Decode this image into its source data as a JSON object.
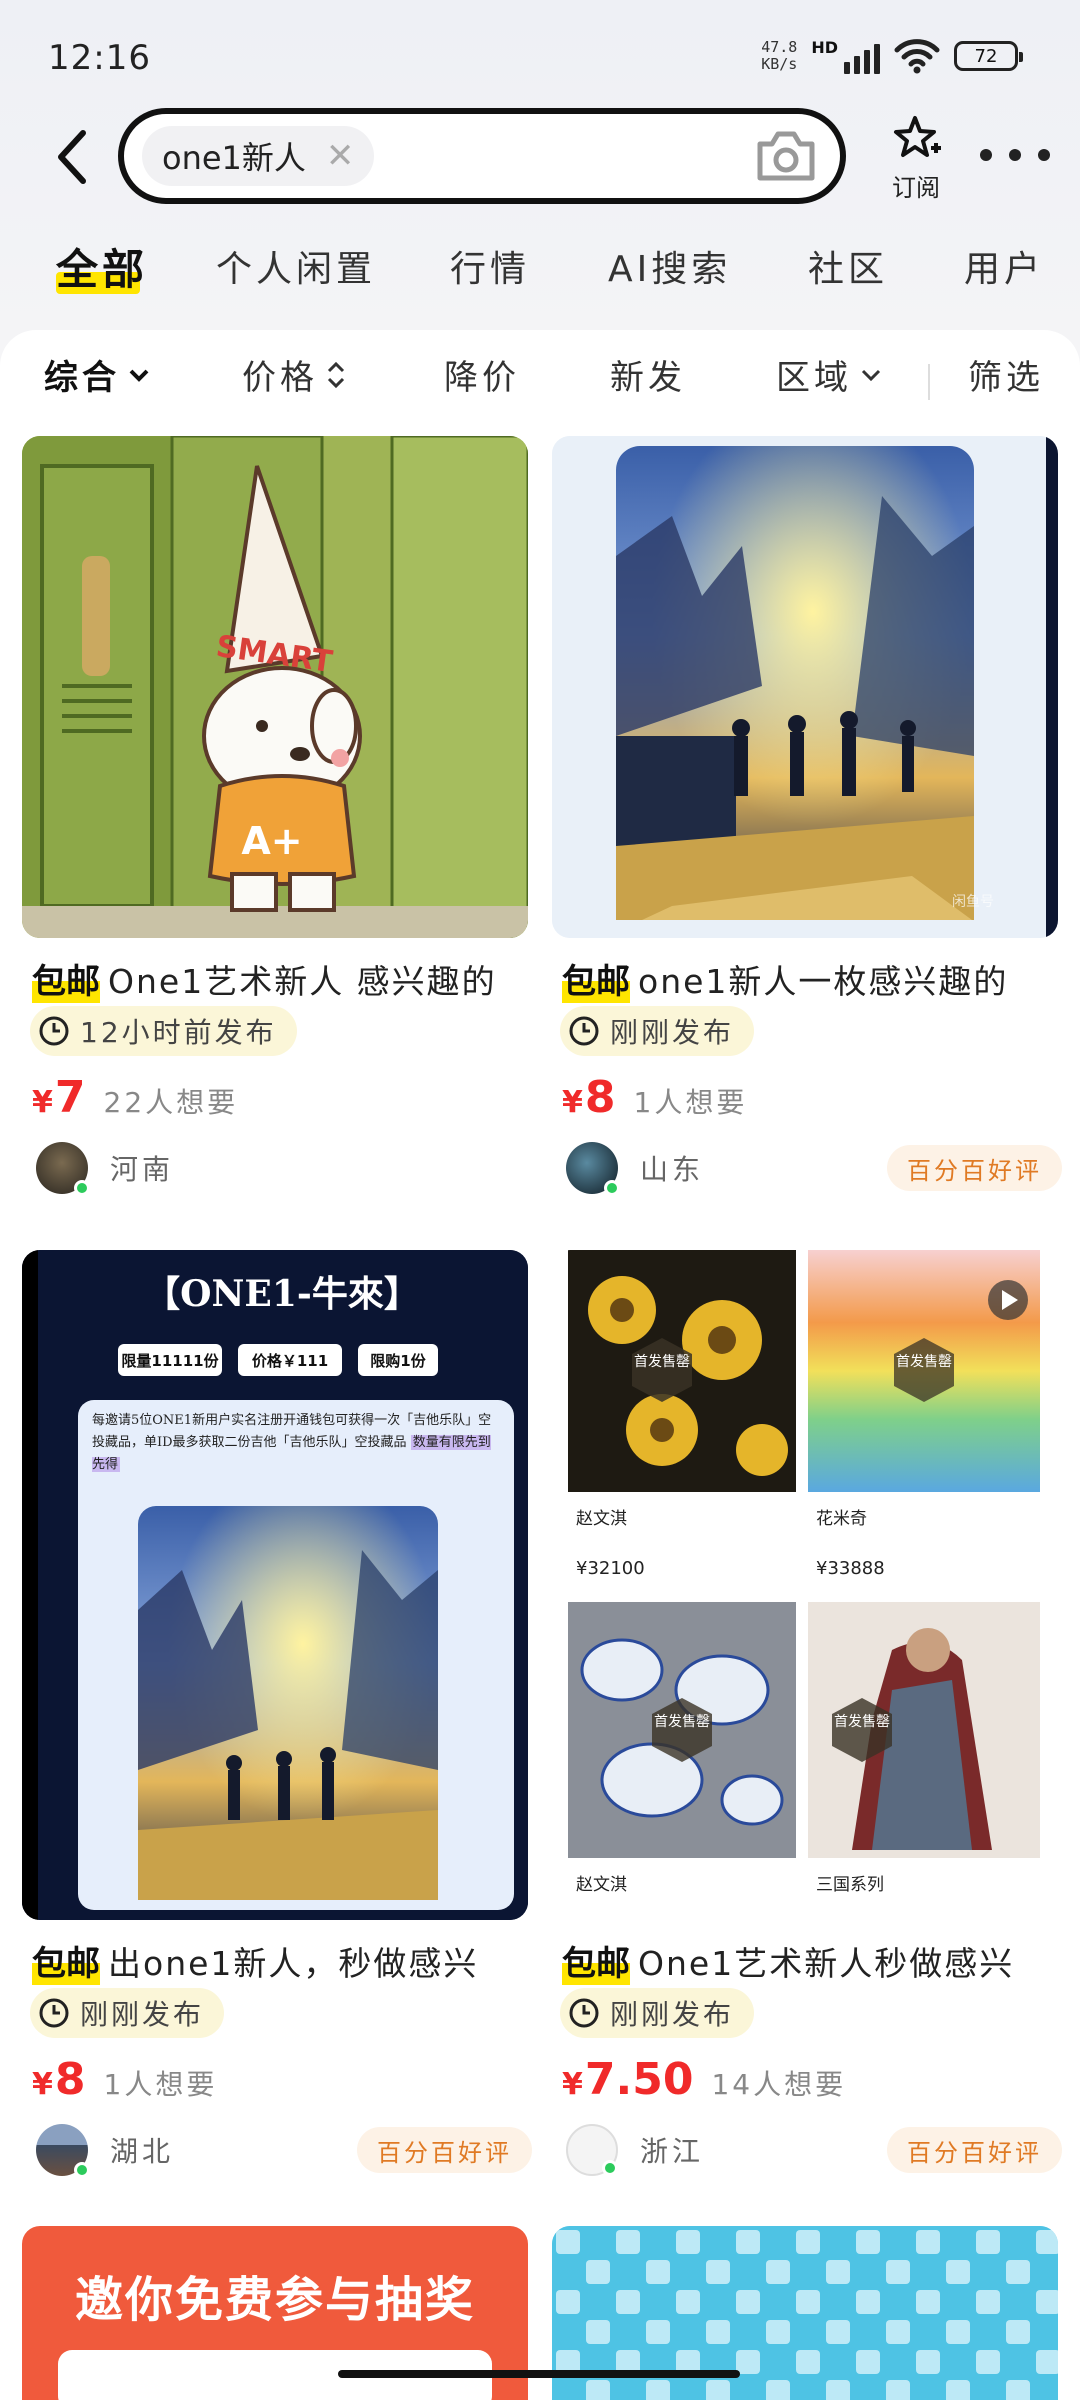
{
  "status_bar": {
    "time": "12:16",
    "net_speed_value": "47.8",
    "net_speed_unit": "KB/s",
    "network_label": "HD",
    "battery": "72"
  },
  "search": {
    "query_chip": "one1新人",
    "subscribe_label": "订阅"
  },
  "category_tabs": [
    {
      "label": "全部",
      "active": true
    },
    {
      "label": "个人闲置"
    },
    {
      "label": "行情"
    },
    {
      "label": "AI搜索"
    },
    {
      "label": "社区"
    },
    {
      "label": "用户"
    }
  ],
  "filters": [
    {
      "label": "综合",
      "icon": "chevron-down-icon",
      "active": true
    },
    {
      "label": "价格",
      "icon": "sort-icon"
    },
    {
      "label": "降价"
    },
    {
      "label": "新发"
    },
    {
      "label": "区域",
      "icon": "chevron-down-icon"
    },
    {
      "label": "筛选"
    }
  ],
  "products": [
    {
      "free_shipping": "包邮",
      "title": "One1艺术新人 感兴趣的",
      "posted": "12小时前发布",
      "price_symbol": "¥",
      "price": "7",
      "wants": "22人想要",
      "location": "河南",
      "image_text": "SMART",
      "image_text_2": "A+"
    },
    {
      "free_shipping": "包邮",
      "title": "one1新人一枚感兴趣的",
      "posted": "刚刚发布",
      "price_symbol": "¥",
      "price": "8",
      "wants": "1人想要",
      "location": "山东",
      "rating": "百分百好评"
    },
    {
      "free_shipping": "包邮",
      "title": "出one1新人，秒做感兴",
      "posted": "刚刚发布",
      "price_symbol": "¥",
      "price": "8",
      "wants": "1人想要",
      "location": "湖北",
      "rating": "百分百好评",
      "poster_title": "【ONE1-牛來】",
      "poster_badges": [
        "限量11111份",
        "价格￥111",
        "限购1份"
      ],
      "poster_desc": "每邀请5位ONE1新用户实名注册开通钱包可获得一次「吉他乐队」空投藏品，单ID最多获取二份吉他「吉他乐队」空投藏品",
      "poster_highlight": "数量有限先到先得"
    },
    {
      "free_shipping": "包邮",
      "title": "One1艺术新人秒做感兴",
      "posted": "刚刚发布",
      "price_symbol": "¥",
      "price": "7.50",
      "wants": "14人想要",
      "location": "浙江",
      "rating": "百分百好评",
      "collage": [
        {
          "stamp": "首发售罄",
          "artist": "赵文淇",
          "price": "¥32100"
        },
        {
          "stamp": "首发售罄",
          "artist": "花米奇",
          "price": "¥33888"
        },
        {
          "stamp": "首发售罄",
          "artist": "赵文淇",
          "price": ""
        },
        {
          "stamp": "首发售罄",
          "artist": "三国系列",
          "price": ""
        }
      ]
    }
  ],
  "promo_banner": "邀你免费参与抽奖",
  "colors": {
    "accent_yellow": "#ffe500",
    "price_red": "#f02a2a",
    "badge_orange": "#e07a24"
  }
}
